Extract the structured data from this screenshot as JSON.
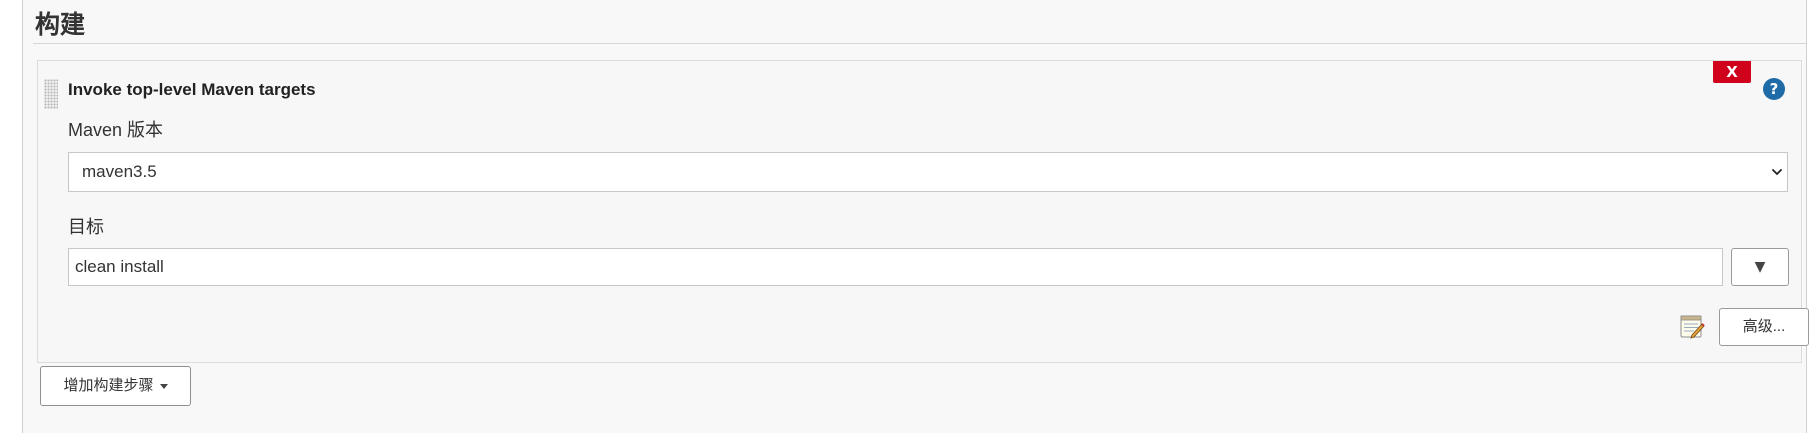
{
  "section": {
    "title": "构建"
  },
  "build_step": {
    "title": "Invoke top-level Maven targets",
    "delete_label": "X",
    "help_label": "?",
    "maven_version_label": "Maven 版本",
    "maven_version_value": "maven3.5",
    "goals_label": "目标",
    "goals_value": "clean install",
    "expand_label": "▼",
    "advanced_label": "高级..."
  },
  "add_step": {
    "label": "增加构建步骤"
  },
  "icons": {
    "drag": "drag-handle-icon",
    "delete": "close-icon",
    "help": "help-icon",
    "select_arrow": "chevron-down-icon",
    "notepad": "notepad-icon",
    "caret": "caret-down-icon"
  },
  "colors": {
    "delete": "#d0021b",
    "help": "#1f6ba8"
  }
}
